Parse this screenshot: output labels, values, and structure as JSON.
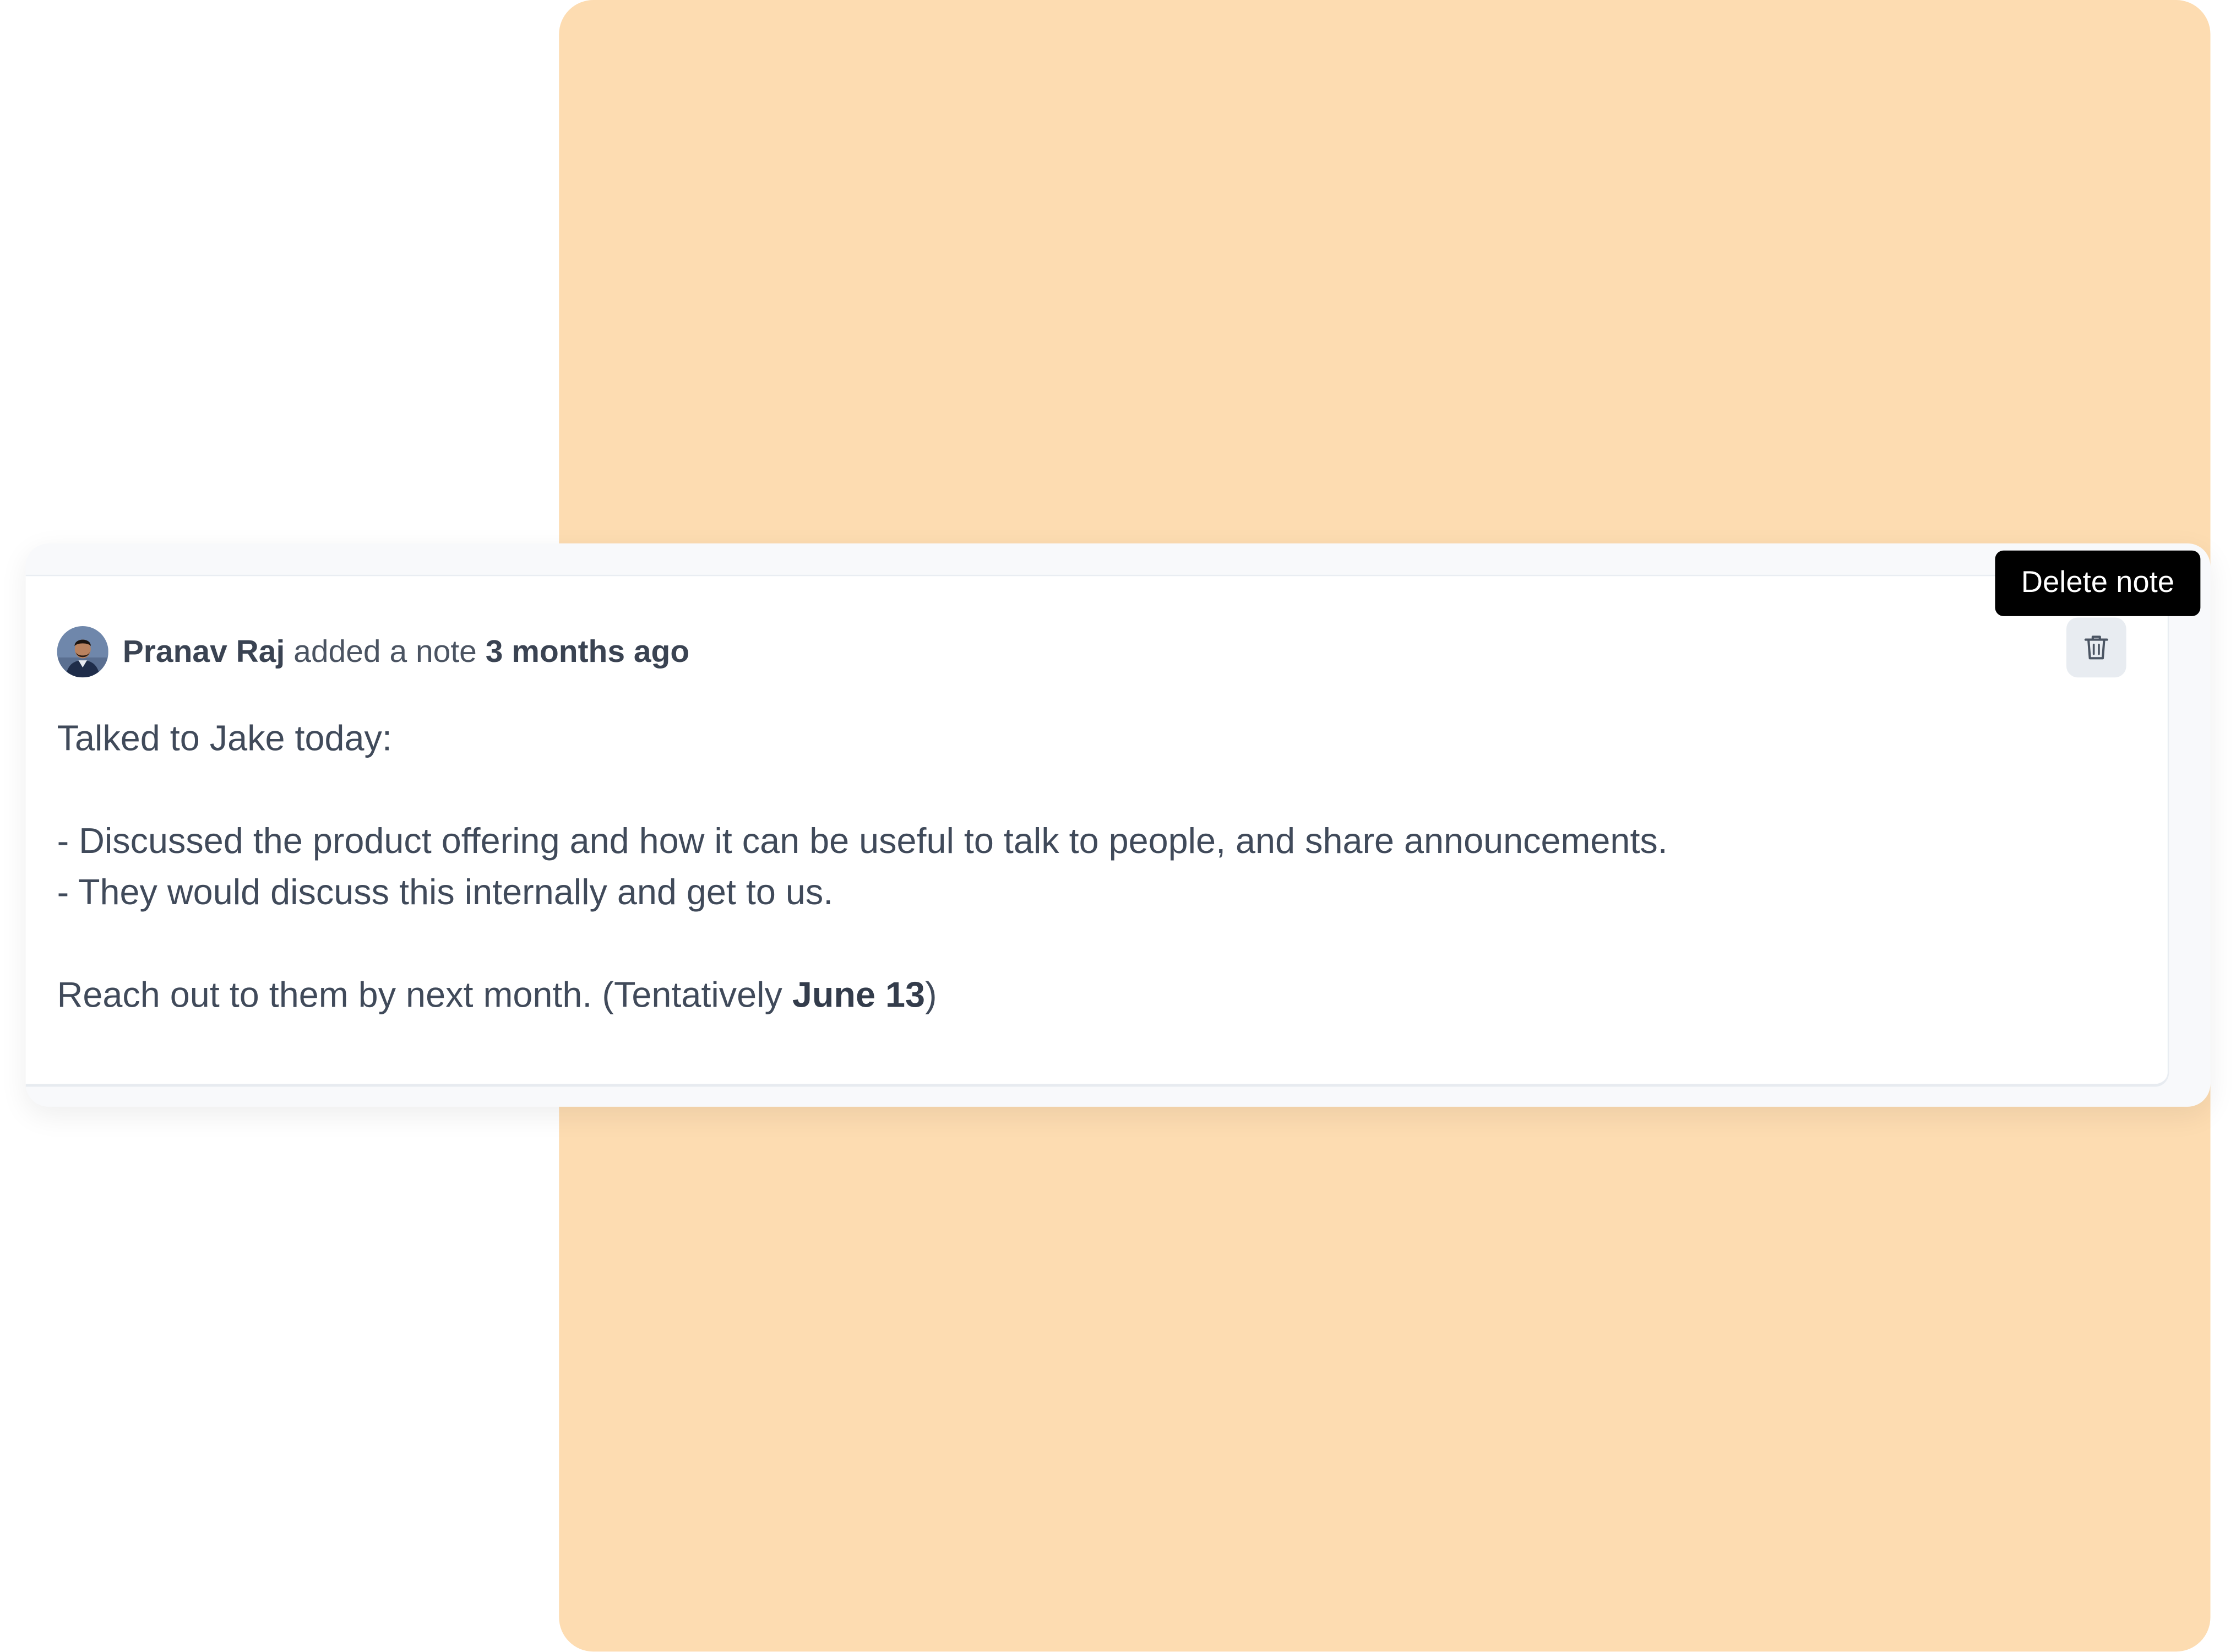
{
  "colors": {
    "background_panel": "#fddcb1",
    "tooltip_bg": "#000000",
    "text_primary": "#404a5a"
  },
  "note": {
    "author": "Pranav Raj",
    "action": "added a note",
    "time": "3 months ago",
    "body": {
      "line1": "Talked to Jake today:",
      "bullet1": "- Discussed the product offering and how it can be useful to talk to people, and share announcements.",
      "bullet2": "- They would discuss this internally and get to us.",
      "reach_prefix": "Reach out to them by next month. (Tentatively ",
      "reach_date": "June 13",
      "reach_suffix": ")"
    },
    "delete_icon": "trash-icon",
    "avatar_icon": "user-avatar"
  },
  "tooltip": {
    "text": "Delete note"
  }
}
